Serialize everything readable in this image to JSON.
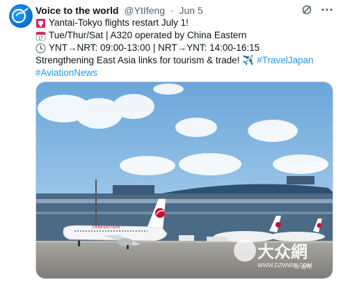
{
  "tweet": {
    "author_name": "Voice to the world",
    "author_handle": "@YtIfeng",
    "separator": "·",
    "date": "Jun 5",
    "lines": [
      {
        "icon": "megaphone-icon",
        "text": "Yantai-Tokyo flights restart July 1!"
      },
      {
        "icon": "calendar-icon",
        "text": "Tue/Thur/Sat | A320 operated by China Eastern"
      },
      {
        "icon": "clock-icon",
        "text": "YNT→NRT: 09:00-13:00 | NRT→YNT: 14:00-16:15"
      },
      {
        "icon": null,
        "text": "Strengthening East Asia links for tourism & trade!"
      }
    ],
    "airplane_emoji": "✈️",
    "hashtags": [
      "#TravelJapan",
      "#AviationNews"
    ]
  },
  "media": {
    "alt": "China Eastern A320 aircraft parked at airport terminal",
    "watermark_text": "大众網",
    "watermark_url": "WWW.DZWWW.COM",
    "watermark_note": "公 发布",
    "airline_label": "CHINA EASTERN",
    "colors": {
      "sky": "#7fb4e0",
      "tail_red": "#c8102e",
      "tarmac": "#8e8c86"
    }
  },
  "colors": {
    "link": "#1d9bf0",
    "secondary": "#536471"
  }
}
